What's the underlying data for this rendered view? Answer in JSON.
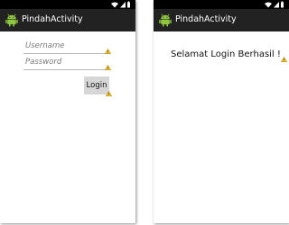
{
  "colors": {
    "status_bar": "#000000",
    "action_bar": "#222222",
    "android_green": "#8ec63f",
    "warning_yellow": "#f4c232",
    "button_bg": "#d6d6d6"
  },
  "status_icons": [
    "wifi-icon",
    "signal-icon",
    "battery-icon"
  ],
  "login_screen": {
    "app_title": "PindahActivity",
    "app_icon": "android-icon",
    "username": {
      "placeholder": "Username",
      "value": ""
    },
    "password": {
      "placeholder": "Password",
      "value": ""
    },
    "login_label": "Login",
    "warning_icon": "lint-warning-icon"
  },
  "success_screen": {
    "app_title": "PindahActivity",
    "app_icon": "android-icon",
    "message": "Selamat Login Berhasil !",
    "warning_icon": "lint-warning-icon"
  }
}
